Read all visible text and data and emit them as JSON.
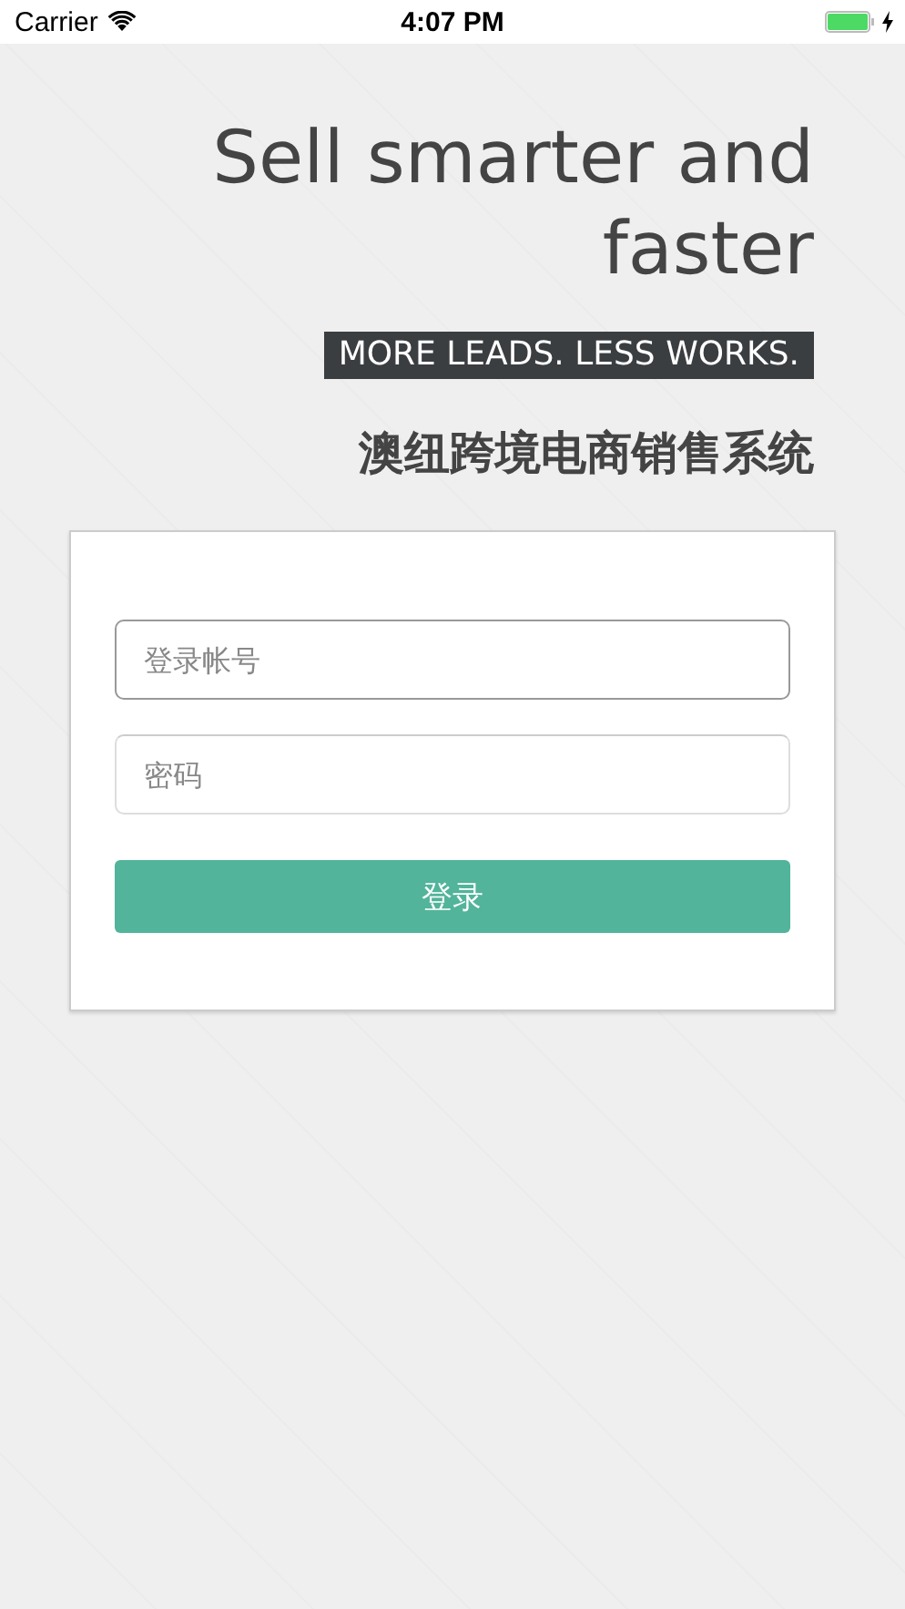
{
  "status_bar": {
    "carrier": "Carrier",
    "time": "4:07 PM",
    "charging": true
  },
  "headline": "Sell smarter and faster",
  "tagline": "MORE LEADS. LESS WORKS.",
  "subtitle": "澳纽跨境电商销售系统",
  "form": {
    "fields": [
      {
        "placeholder": "登录帐号",
        "focused": true
      },
      {
        "placeholder": "密码",
        "focused": false
      }
    ],
    "submit": "登录"
  }
}
